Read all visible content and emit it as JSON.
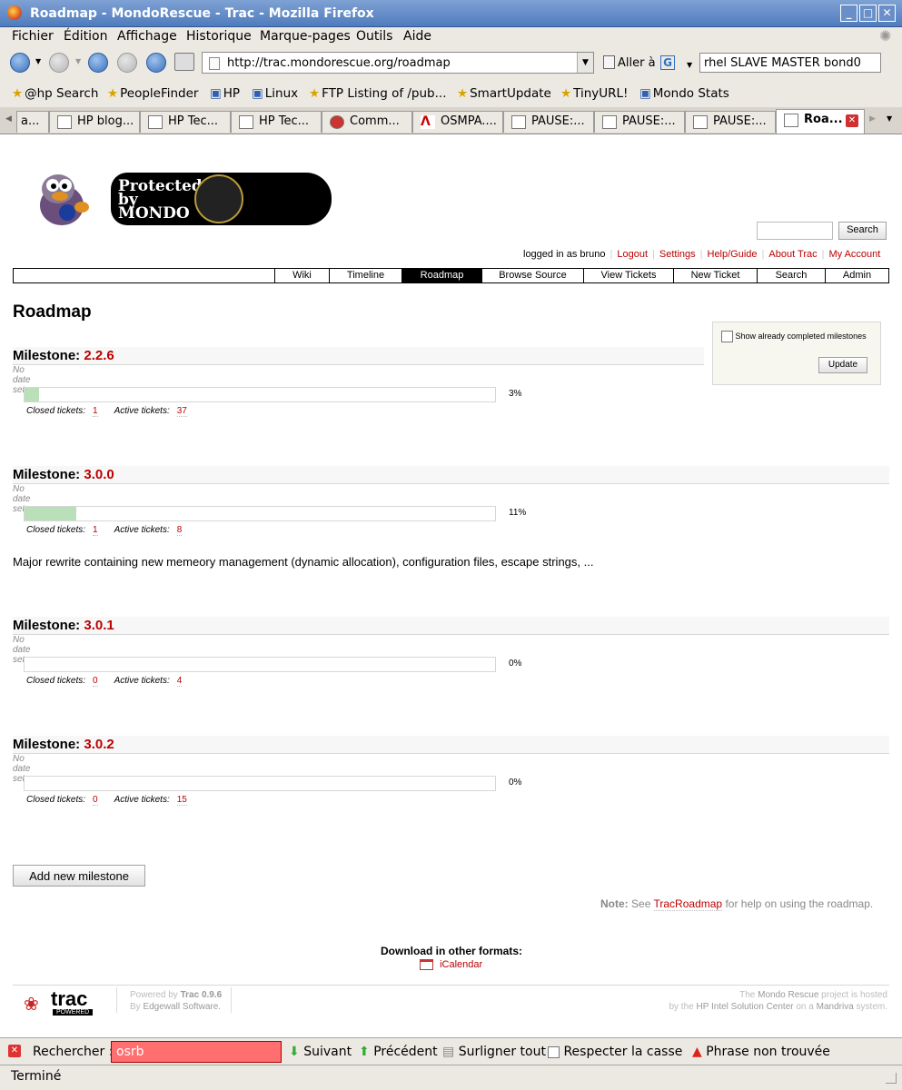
{
  "window": {
    "title": "Roadmap - MondoRescue - Trac - Mozilla Firefox"
  },
  "menu": [
    "Fichier",
    "Édition",
    "Affichage",
    "Historique",
    "Marque-pages",
    "Outils",
    "Aide"
  ],
  "nav": {
    "url": "http://trac.mondorescue.org/roadmap",
    "go_label": "Aller à",
    "search_value": "rhel SLAVE MASTER bond0"
  },
  "bookmarks": [
    "@hp Search",
    "PeopleFinder",
    "HP",
    "Linux",
    "FTP Listing of /pub...",
    "SmartUpdate",
    "TinyURL!",
    "Mondo Stats"
  ],
  "tabs": [
    "a...",
    "HP blog...",
    "HP Tec...",
    "HP Tec...",
    "Comm...",
    "OSMPA....",
    "PAUSE:...",
    "PAUSE:...",
    "PAUSE:...",
    "Roa..."
  ],
  "trac": {
    "logo_text": "Protected by MONDO",
    "search_button": "Search",
    "metanav": {
      "logged_in": "logged in as bruno",
      "links": [
        "Logout",
        "Settings",
        "Help/Guide",
        "About Trac",
        "My Account"
      ]
    },
    "mainnav": [
      "Wiki",
      "Timeline",
      "Roadmap",
      "Browse Source",
      "View Tickets",
      "New Ticket",
      "Search",
      "Admin"
    ],
    "page_title": "Roadmap",
    "milestone_prefix": "Milestone:",
    "closed_label": "Closed tickets:",
    "active_label": "Active tickets:",
    "milestones": [
      {
        "name": "2.2.6",
        "date": "No date set",
        "percent": 3,
        "percent_label": "3%",
        "closed": "1",
        "active": "37"
      },
      {
        "name": "3.0.0",
        "date": "No date set",
        "percent": 11,
        "percent_label": "11%",
        "closed": "1",
        "active": "8",
        "description": "Major rewrite containing new memeory management (dynamic allocation), configuration files, escape strings, ..."
      },
      {
        "name": "3.0.1",
        "date": "No date set",
        "percent": 0,
        "percent_label": "0%",
        "closed": "0",
        "active": "4"
      },
      {
        "name": "3.0.2",
        "date": "No date set",
        "percent": 0,
        "percent_label": "0%",
        "closed": "0",
        "active": "15"
      }
    ],
    "prefs": {
      "show_completed_label": "Show already completed milestones",
      "update_button": "Update"
    },
    "add_milestone_button": "Add new milestone",
    "note": {
      "label": "Note:",
      "pre": "See",
      "link": "TracRoadmap",
      "post": "for help on using the roadmap."
    },
    "download": {
      "title": "Download in other formats:",
      "ical": "iCalendar"
    },
    "footer": {
      "trac_logo": "trac",
      "trac_powered": "POWERED",
      "powered_by": "Powered by",
      "trac_version": "Trac 0.9.6",
      "by": "By",
      "edgewall": "Edgewall Software.",
      "hosted_pre": "The",
      "hosted_project": "Mondo Rescue",
      "hosted_post": "project is hosted",
      "by_pre": "by the",
      "hp_center": "HP Intel Solution Center",
      "on_a": "on a",
      "mandriva": "Mandriva",
      "system": "system."
    }
  },
  "findbar": {
    "label": "Rechercher :",
    "value": "osrb",
    "next": "Suivant",
    "prev": "Précédent",
    "highlight": "Surligner tout",
    "matchcase": "Respecter la casse",
    "status": "Phrase non trouvée"
  },
  "status": "Terminé"
}
